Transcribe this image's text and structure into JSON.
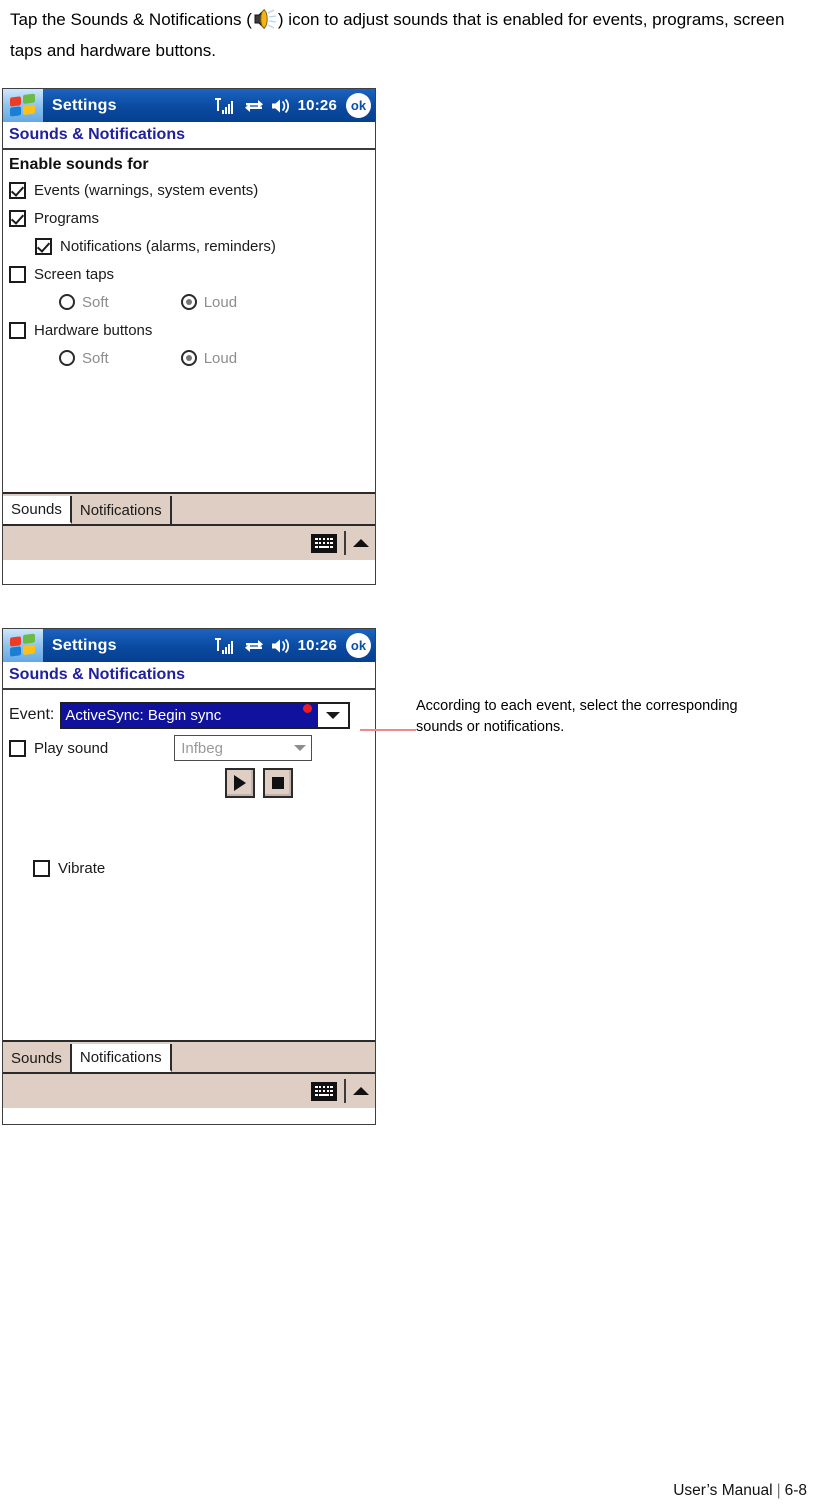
{
  "intro": {
    "before_icon": "Tap the Sounds & Notifications (",
    "icon_name": "speaker-sound-icon",
    "after_icon": ") icon to adjust sounds that is enabled for events, programs, screen taps and hardware buttons."
  },
  "screens": [
    {
      "id": "sounds",
      "titlebar": {
        "start_icon": "windows-start-icon",
        "title": "Settings",
        "signal_icon": "signal-strength-icon",
        "connectivity_icon": "connectivity-icon",
        "volume_icon": "volume-speaker-icon",
        "time": "10:26",
        "ok_label": "ok"
      },
      "page_title": "Sounds & Notifications",
      "group_title": "Enable sounds for",
      "options": [
        {
          "label": "Events (warnings, system events)",
          "checked": true,
          "indent": 0
        },
        {
          "label": "Programs",
          "checked": true,
          "indent": 0
        },
        {
          "label": "Notifications (alarms, reminders)",
          "checked": true,
          "indent": 1
        },
        {
          "label": "Screen taps",
          "checked": false,
          "indent": 0
        }
      ],
      "screen_taps_radios": {
        "soft": "Soft",
        "loud": "Loud",
        "selected": "Loud"
      },
      "hardware_label": "Hardware buttons",
      "hardware_checked": false,
      "hardware_radios": {
        "soft": "Soft",
        "loud": "Loud",
        "selected": "Loud"
      },
      "tabs": [
        {
          "label": "Sounds",
          "active": true
        },
        {
          "label": "Notifications",
          "active": false
        }
      ],
      "softbar": {
        "keyboard_icon": "keyboard-icon",
        "arrow_icon": "up-arrow-icon"
      }
    },
    {
      "id": "notifications",
      "titlebar": {
        "start_icon": "windows-start-icon",
        "title": "Settings",
        "signal_icon": "signal-strength-icon",
        "connectivity_icon": "connectivity-icon",
        "volume_icon": "volume-speaker-icon",
        "time": "10:26",
        "ok_label": "ok"
      },
      "page_title": "Sounds & Notifications",
      "event_label": "Event:",
      "event_value": "ActiveSync: Begin sync",
      "play_sound_label": "Play sound",
      "play_sound_checked": false,
      "sound_value": "Infbeg",
      "transport": {
        "play_icon": "play-icon",
        "stop_icon": "stop-icon"
      },
      "vibrate_label": "Vibrate",
      "vibrate_checked": false,
      "tabs": [
        {
          "label": "Sounds",
          "active": false
        },
        {
          "label": "Notifications",
          "active": true
        }
      ],
      "softbar": {
        "keyboard_icon": "keyboard-icon",
        "arrow_icon": "up-arrow-icon"
      }
    }
  ],
  "callout": {
    "text": "According to each event, select the corresponding sounds or notifications."
  },
  "footer": {
    "manual_label": "User’s Manual",
    "divider": "|",
    "page_number": "6-8"
  },
  "colors": {
    "titlebar_blue": "#0b4fa8",
    "page_title_blue": "#22219c",
    "selection_blue": "#10119c",
    "chrome_tan": "#dfcec3",
    "callout_red": "#f08a8a",
    "dot_red": "#ec1c24"
  }
}
